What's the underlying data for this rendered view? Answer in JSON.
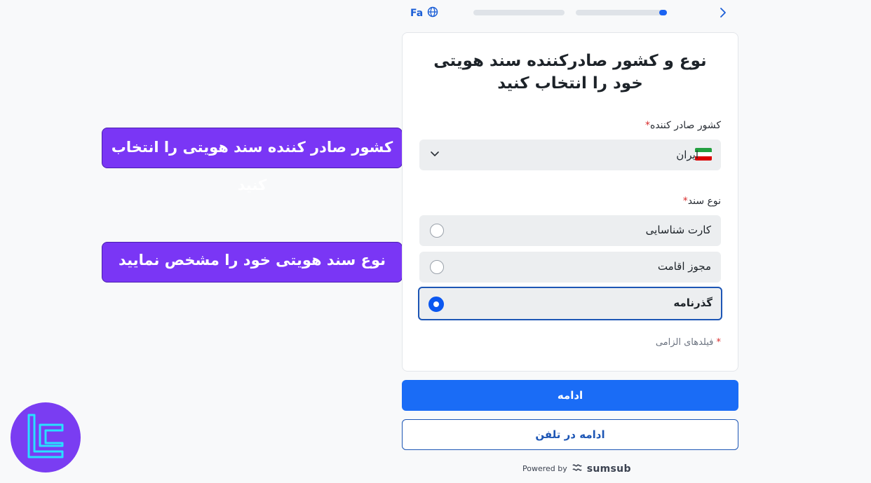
{
  "topbar": {
    "language_label": "Fa",
    "progress": [
      {
        "step": 1,
        "fill": 0.0
      },
      {
        "step": 2,
        "fill": 0.08
      }
    ]
  },
  "card": {
    "title": "نوع و کشور صادرکننده سند هویتی خود را انتخاب کنید",
    "country_label": "کشور صادر کننده",
    "required_mark": "*",
    "country_value": "ایران",
    "doc_type_label": "نوع سند",
    "options": [
      {
        "label": "کارت شناسایی",
        "selected": false
      },
      {
        "label": "مجوز اقامت",
        "selected": false
      },
      {
        "label": "گذرنامه",
        "selected": true
      }
    ],
    "required_note": "فیلدهای الزامی"
  },
  "buttons": {
    "continue_label": "ادامه",
    "continue_phone_label": "ادامه در تلفن"
  },
  "footer": {
    "powered_by": "Powered by",
    "brand": "sumsub"
  },
  "callouts": {
    "country": "کشور صادر کننده سند هویتی را انتخاب کنید",
    "doc_type": "نوع سند هویتی خود را مشخص نمایید"
  },
  "colors": {
    "accent": "#1a6cf6",
    "callout": "#7a36f5",
    "required": "#d92b2b"
  }
}
